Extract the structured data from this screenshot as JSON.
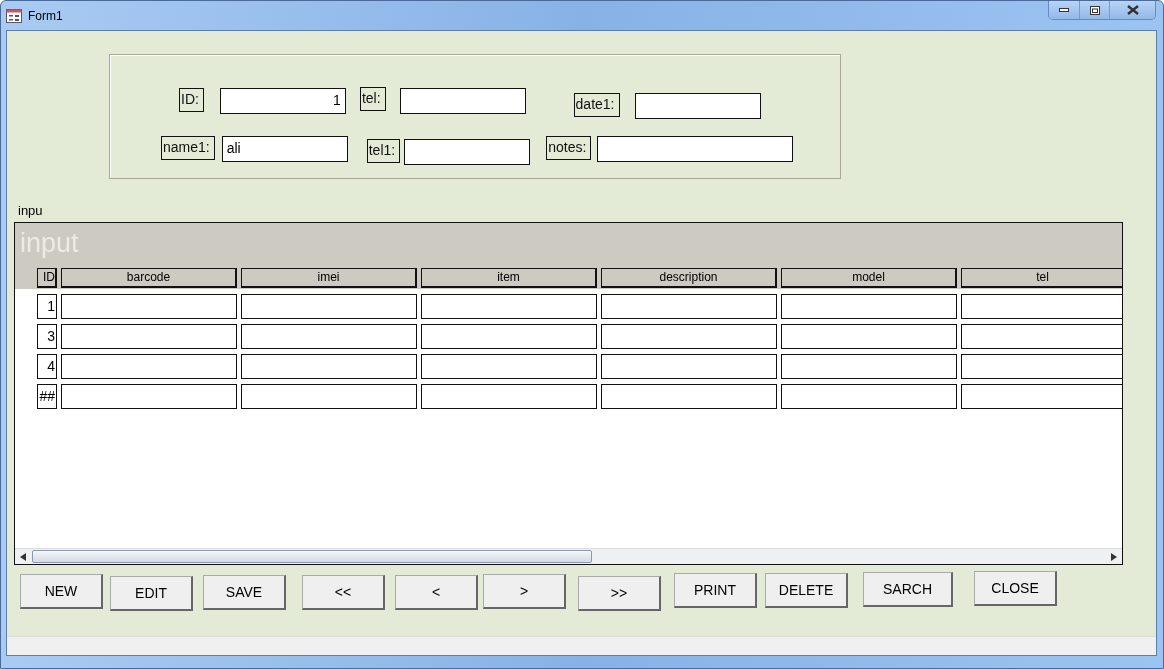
{
  "window": {
    "title": "Form1"
  },
  "header_rows": [
    [
      {
        "label": "ID:",
        "value": "1",
        "kind": "number"
      },
      {
        "label": "tel:",
        "kind": "text"
      },
      {
        "label": "date1:",
        "kind": "text"
      }
    ],
    [
      {
        "label": "name1:",
        "value": "ali",
        "kind": "text"
      },
      {
        "label": "tel1:",
        "kind": "text"
      },
      {
        "label": "notes:",
        "kind": "text"
      }
    ]
  ],
  "subform": {
    "caption": "inpu",
    "title": "input",
    "columns": [
      "ID",
      "barcode",
      "imei",
      "item",
      "description",
      "model",
      "tel"
    ],
    "rows": [
      {
        "id": "1"
      },
      {
        "id": "3"
      },
      {
        "id": "4"
      },
      {
        "id": "##"
      }
    ]
  },
  "buttons": [
    "NEW",
    "EDIT",
    "SAVE",
    "<<",
    "<",
    ">",
    ">>",
    "PRINT",
    "DELETE",
    "SARCH",
    "CLOSE"
  ]
}
